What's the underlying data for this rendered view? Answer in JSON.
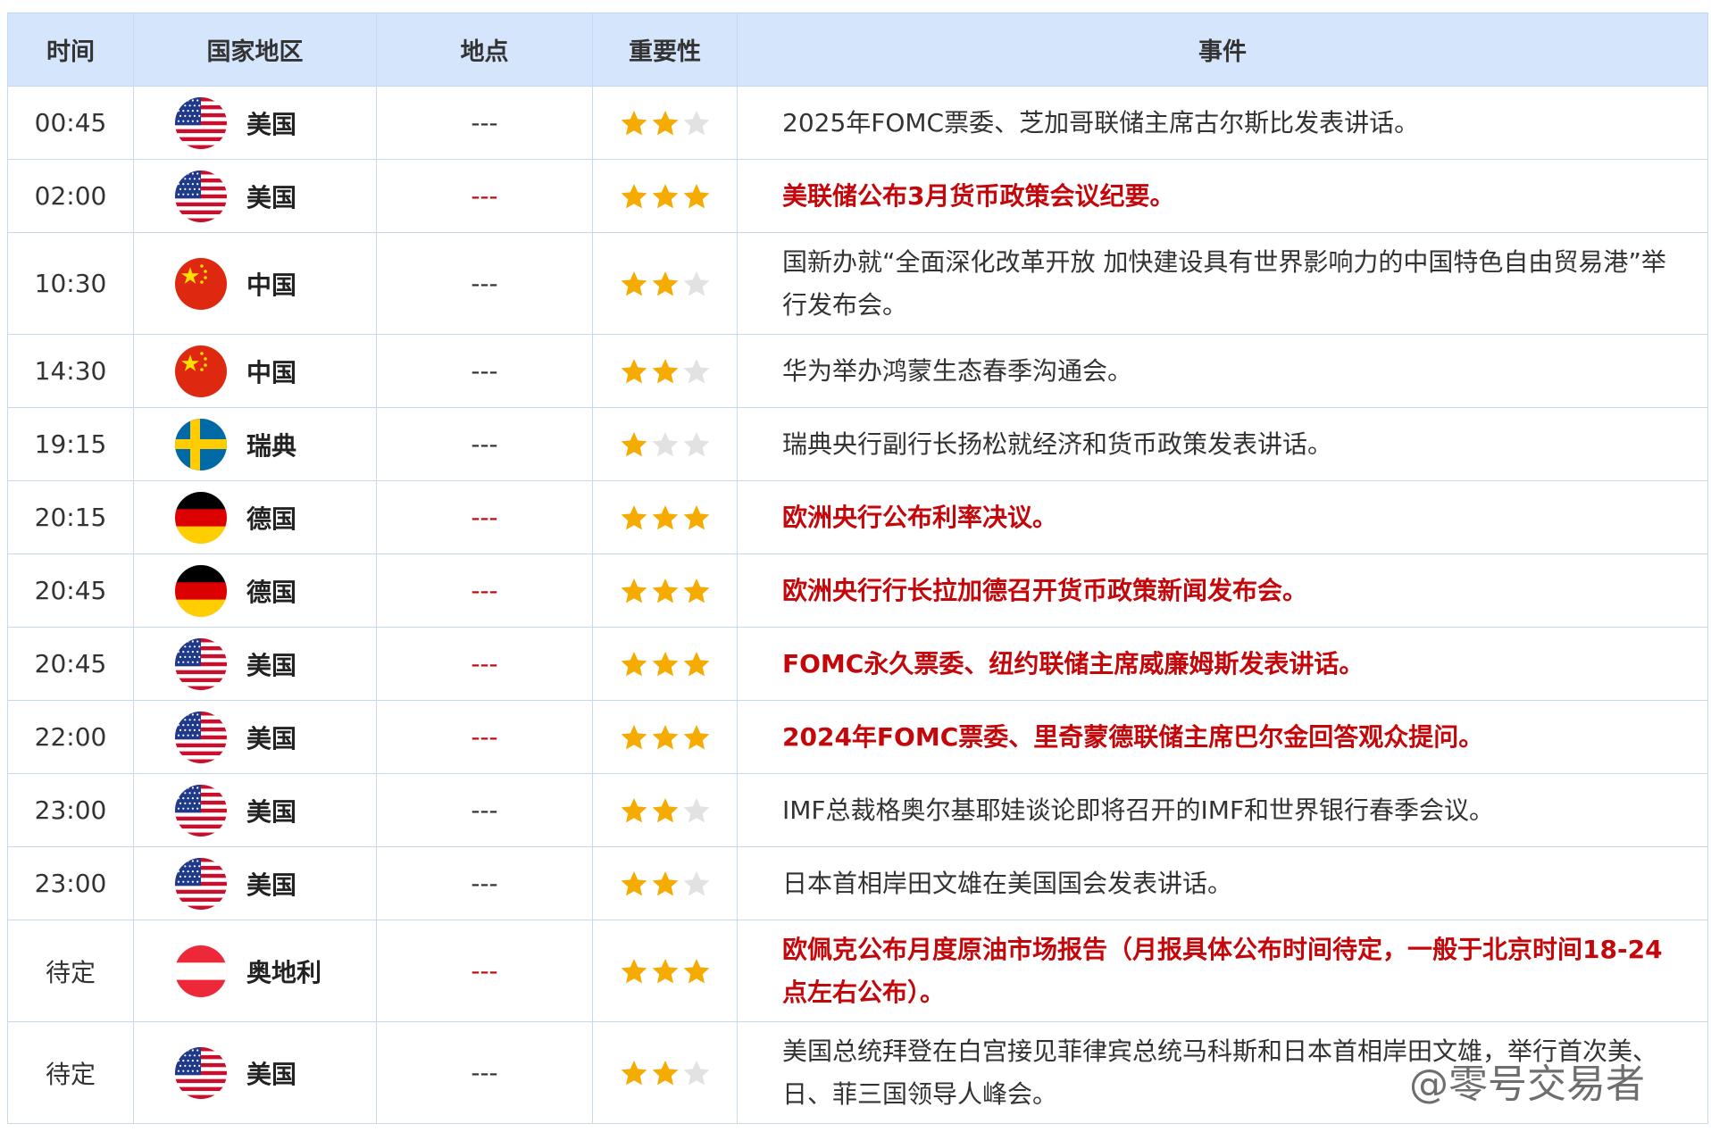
{
  "columns": [
    "时间",
    "国家地区",
    "地点",
    "重要性",
    "事件"
  ],
  "colors": {
    "header_bg": "#d4e5fc",
    "border": "#c6d9f1",
    "highlight": "#c4070b",
    "star_on": "#f6ab00",
    "star_off": "#e2e2e2"
  },
  "rows": [
    {
      "time": "00:45",
      "country": "美国",
      "flag": "us-flag-icon",
      "place": "---",
      "stars": 2,
      "event": "2025年FOMC票委、芝加哥联储主席古尔斯比发表讲话。",
      "highlight": false
    },
    {
      "time": "02:00",
      "country": "美国",
      "flag": "us-flag-icon",
      "place": "---",
      "stars": 3,
      "event": "美联储公布3月货币政策会议纪要。",
      "highlight": true
    },
    {
      "time": "10:30",
      "country": "中国",
      "flag": "china-flag-icon",
      "place": "---",
      "stars": 2,
      "event": "国新办就“全面深化改革开放 加快建设具有世界影响力的中国特色自由贸易港”举行发布会。",
      "highlight": false
    },
    {
      "time": "14:30",
      "country": "中国",
      "flag": "china-flag-icon",
      "place": "---",
      "stars": 2,
      "event": "华为举办鸿蒙生态春季沟通会。",
      "highlight": false
    },
    {
      "time": "19:15",
      "country": "瑞典",
      "flag": "sweden-flag-icon",
      "place": "---",
      "stars": 1,
      "event": "瑞典央行副行长扬松就经济和货币政策发表讲话。",
      "highlight": false
    },
    {
      "time": "20:15",
      "country": "德国",
      "flag": "germany-flag-icon",
      "place": "---",
      "stars": 3,
      "event": "欧洲央行公布利率决议。",
      "highlight": true
    },
    {
      "time": "20:45",
      "country": "德国",
      "flag": "germany-flag-icon",
      "place": "---",
      "stars": 3,
      "event": "欧洲央行行长拉加德召开货币政策新闻发布会。",
      "highlight": true
    },
    {
      "time": "20:45",
      "country": "美国",
      "flag": "us-flag-icon",
      "place": "---",
      "stars": 3,
      "event": "FOMC永久票委、纽约联储主席威廉姆斯发表讲话。",
      "highlight": true
    },
    {
      "time": "22:00",
      "country": "美国",
      "flag": "us-flag-icon",
      "place": "---",
      "stars": 3,
      "event": "2024年FOMC票委、里奇蒙德联储主席巴尔金回答观众提问。",
      "highlight": true
    },
    {
      "time": "23:00",
      "country": "美国",
      "flag": "us-flag-icon",
      "place": "---",
      "stars": 2,
      "event": "IMF总裁格奥尔基耶娃谈论即将召开的IMF和世界银行春季会议。",
      "highlight": false
    },
    {
      "time": "23:00",
      "country": "美国",
      "flag": "us-flag-icon",
      "place": "---",
      "stars": 2,
      "event": "日本首相岸田文雄在美国国会发表讲话。",
      "highlight": false
    },
    {
      "time": "待定",
      "country": "奥地利",
      "flag": "austria-flag-icon",
      "place": "---",
      "stars": 3,
      "event": "欧佩克公布月度原油市场报告（月报具体公布时间待定，一般于北京时间18-24点左右公布）。",
      "highlight": true
    },
    {
      "time": "待定",
      "country": "美国",
      "flag": "us-flag-icon",
      "place": "---",
      "stars": 2,
      "event": "美国总统拜登在白宫接见菲律宾总统马科斯和日本首相岸田文雄，举行首次美、日、菲三国领导人峰会。",
      "highlight": false
    }
  ],
  "watermark": "@零号交易者"
}
